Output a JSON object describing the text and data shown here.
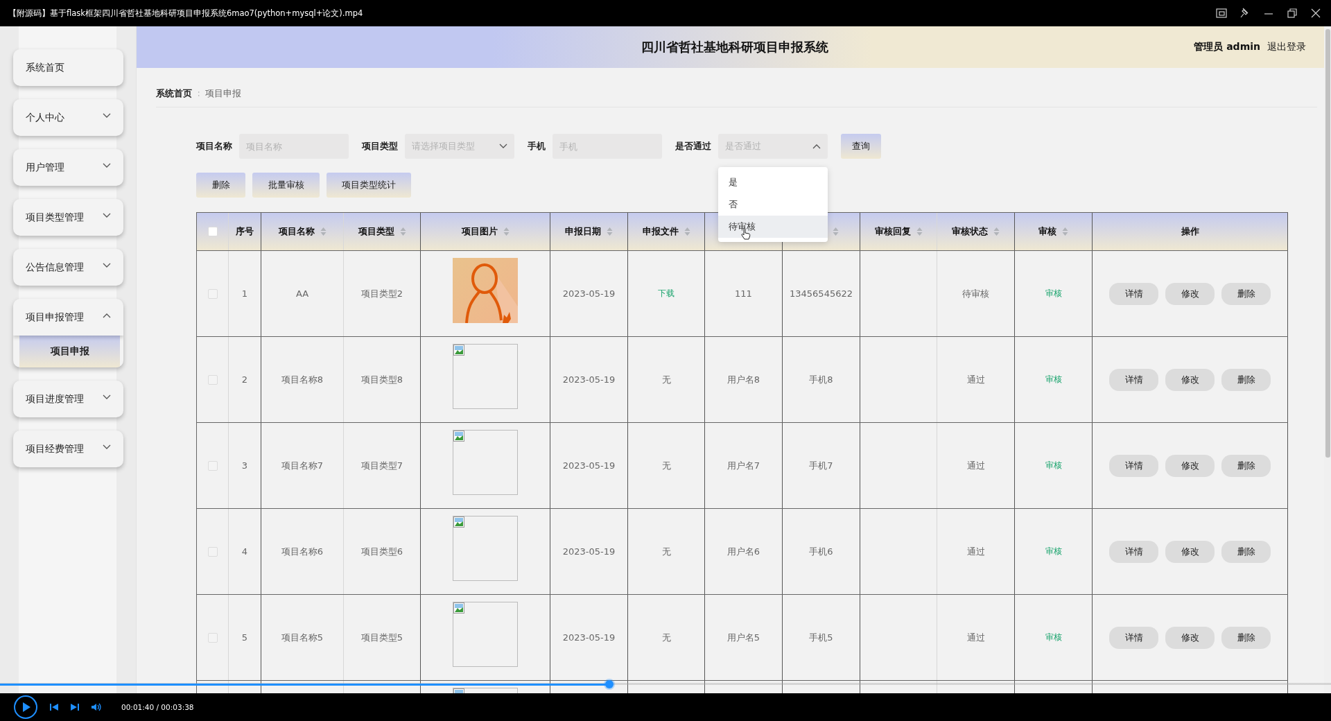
{
  "window": {
    "title": "【附源码】基于flask框架四川省哲社基地科研项目申报系统6mao7(python+mysql+论文).mp4"
  },
  "sidebar": {
    "items": [
      {
        "label": "系统首页"
      },
      {
        "label": "个人中心",
        "expanded": false
      },
      {
        "label": "用户管理",
        "expanded": false
      },
      {
        "label": "项目类型管理",
        "expanded": false
      },
      {
        "label": "公告信息管理",
        "expanded": false
      },
      {
        "label": "项目申报管理",
        "expanded": true,
        "children": [
          {
            "label": "项目申报",
            "selected": true
          }
        ]
      },
      {
        "label": "项目进度管理",
        "expanded": false
      },
      {
        "label": "项目经费管理",
        "expanded": false
      }
    ]
  },
  "header": {
    "title": "四川省哲社基地科研项目申报系统",
    "user": "管理员 admin",
    "logout": "退出登录"
  },
  "breadcrumb": {
    "separator": "∶",
    "items": [
      {
        "label": "系统首页",
        "current": false
      },
      {
        "label": "项目申报",
        "current": true
      }
    ]
  },
  "search": {
    "fields": [
      {
        "label": "项目名称",
        "kind": "input",
        "placeholder": "项目名称"
      },
      {
        "label": "项目类型",
        "kind": "select",
        "placeholder": "请选择项目类型",
        "open": false
      },
      {
        "label": "手机",
        "kind": "input",
        "placeholder": "手机"
      },
      {
        "label": "是否通过",
        "kind": "select",
        "placeholder": "是否通过",
        "open": true,
        "options": [
          {
            "label": "是",
            "selected": false
          },
          {
            "label": "否",
            "selected": false
          },
          {
            "label": "待审核",
            "selected": true
          }
        ]
      }
    ],
    "button": "查询"
  },
  "actions": [
    "删除",
    "批量审核",
    "项目类型统计"
  ],
  "table": {
    "columns": [
      {
        "kind": "checkbox",
        "checked": false
      },
      {
        "label": "序号",
        "sortable": false
      },
      {
        "label": "项目名称",
        "sortable": true
      },
      {
        "label": "项目类型",
        "sortable": true
      },
      {
        "label": "项目图片",
        "sortable": true
      },
      {
        "label": "申报日期",
        "sortable": true
      },
      {
        "label": "申报文件",
        "sortable": true
      },
      {
        "kind": "blank"
      },
      {
        "sortable": true
      },
      {
        "label": "审核回复",
        "sortable": true
      },
      {
        "label": "审核状态",
        "sortable": true
      },
      {
        "label": "审核",
        "sortable": true
      },
      {
        "label": "操作",
        "sortable": false
      }
    ],
    "rows": [
      {
        "checked": false,
        "no": "1",
        "name": "AA",
        "type": "项目类型2",
        "image": {
          "kind": "picture"
        },
        "date": "2023-05-19",
        "file": {
          "text": "下载",
          "link": true
        },
        "user": "111",
        "phone": "13456545622",
        "status": "待审核",
        "review": "审核",
        "actions": [
          "详情",
          "修改",
          "删除"
        ]
      },
      {
        "checked": false,
        "no": "2",
        "name": "项目名称8",
        "type": "项目类型8",
        "image": {
          "kind": "broken"
        },
        "date": "2023-05-19",
        "file": {
          "text": "无",
          "link": false
        },
        "user": "用户名8",
        "phone": "手机8",
        "status": "通过",
        "review": "审核",
        "actions": [
          "详情",
          "修改",
          "删除"
        ]
      },
      {
        "checked": false,
        "no": "3",
        "name": "项目名称7",
        "type": "项目类型7",
        "image": {
          "kind": "broken"
        },
        "date": "2023-05-19",
        "file": {
          "text": "无",
          "link": false
        },
        "user": "用户名7",
        "phone": "手机7",
        "status": "通过",
        "review": "审核",
        "actions": [
          "详情",
          "修改",
          "删除"
        ]
      },
      {
        "checked": false,
        "no": "4",
        "name": "项目名称6",
        "type": "项目类型6",
        "image": {
          "kind": "broken"
        },
        "date": "2023-05-19",
        "file": {
          "text": "无",
          "link": false
        },
        "user": "用户名6",
        "phone": "手机6",
        "status": "通过",
        "review": "审核",
        "actions": [
          "详情",
          "修改",
          "删除"
        ]
      },
      {
        "checked": false,
        "no": "5",
        "name": "项目名称5",
        "type": "项目类型5",
        "image": {
          "kind": "broken"
        },
        "date": "2023-05-19",
        "file": {
          "text": "无",
          "link": false
        },
        "user": "用户名5",
        "phone": "手机5",
        "status": "通过",
        "review": "审核",
        "actions": [
          "详情",
          "修改",
          "删除"
        ]
      },
      {
        "image": {
          "kind": "broken"
        }
      }
    ]
  },
  "player": {
    "time": "00:01:40 / 00:03:38",
    "progress": {
      "level": 0.458
    }
  }
}
